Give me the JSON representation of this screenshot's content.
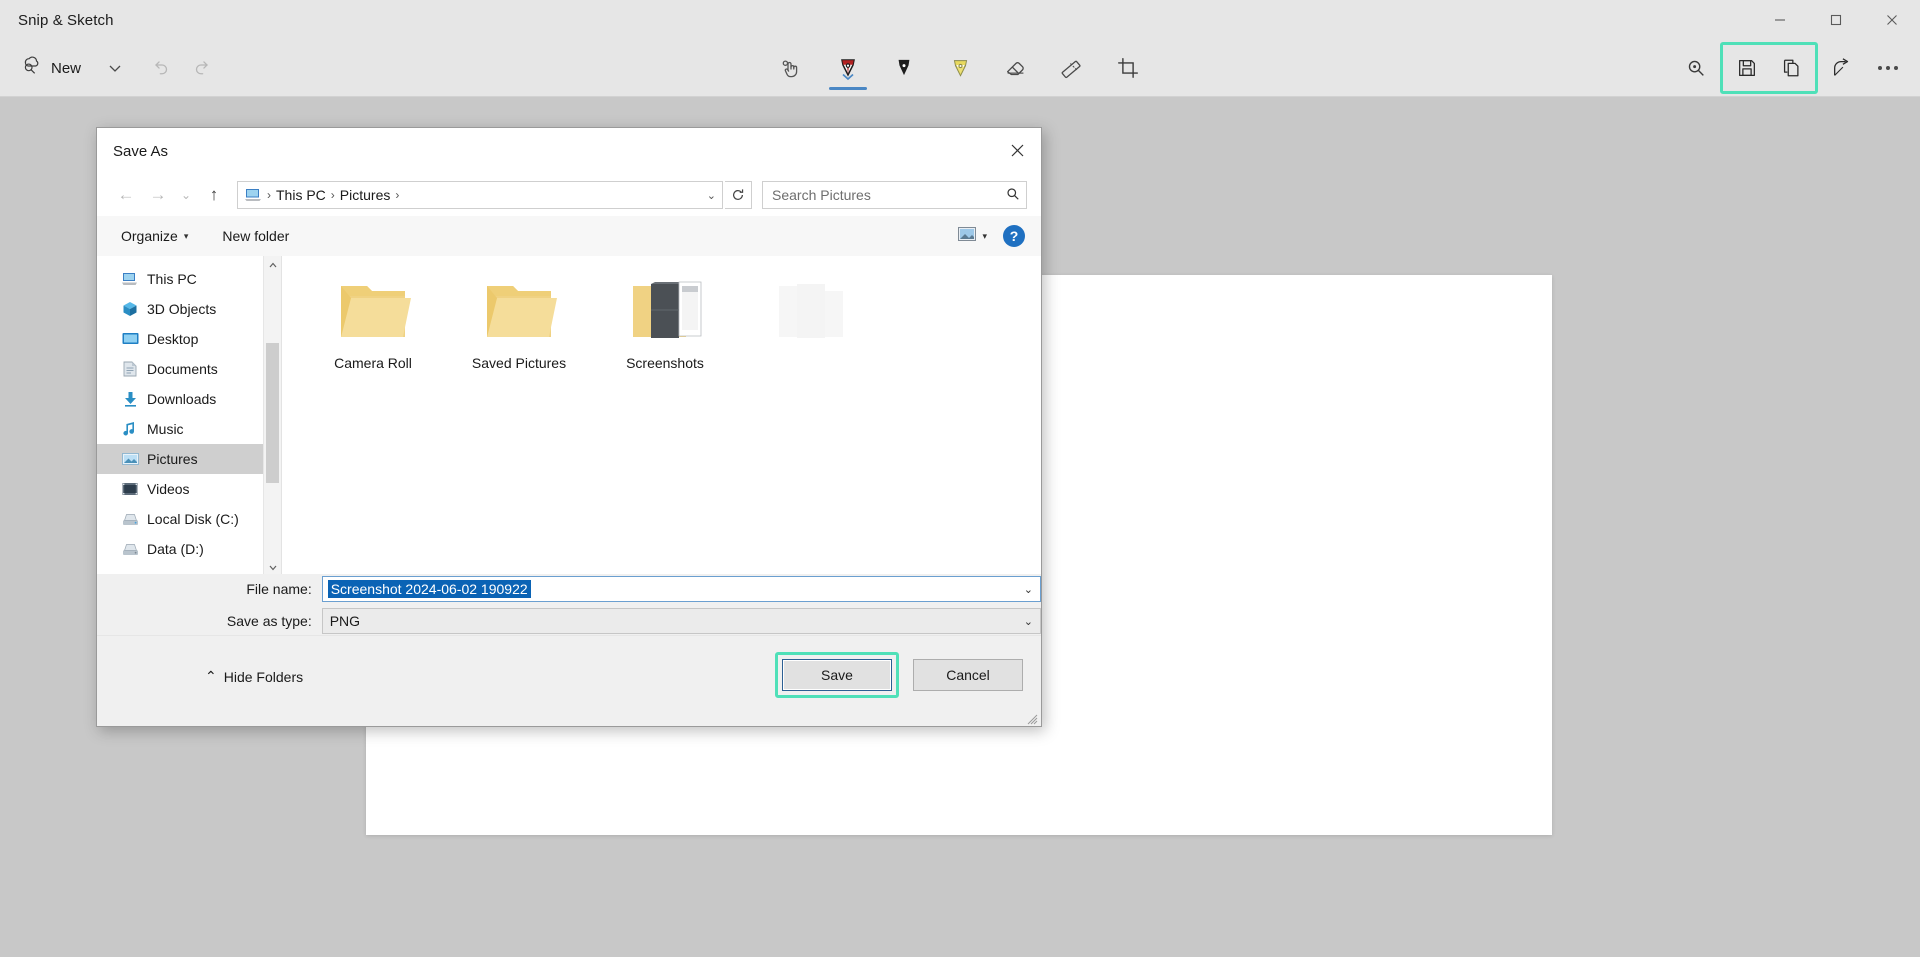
{
  "app": {
    "title": "Snip & Sketch",
    "window_controls": [
      {
        "name": "minimize",
        "glyph": "—"
      },
      {
        "name": "maximize",
        "glyph": "❐"
      },
      {
        "name": "close",
        "glyph": "✕"
      }
    ]
  },
  "toolbar": {
    "new_label": "New",
    "new_caret": "⌄",
    "undo_name": "undo-icon",
    "redo_name": "redo-icon",
    "tools": [
      {
        "id": "touch-writing",
        "label": "Touch writing",
        "color": "#6e6e6e",
        "selected": false
      },
      {
        "id": "ballpoint-pen",
        "label": "Ballpoint pen",
        "color": "#b22222",
        "selected": true
      },
      {
        "id": "pencil",
        "label": "Pencil",
        "color": "#1c1c1c",
        "selected": false
      },
      {
        "id": "highlighter",
        "label": "Highlighter",
        "color": "#e3d15a",
        "selected": false
      },
      {
        "id": "eraser",
        "label": "Eraser",
        "color": "#5a5a5a",
        "selected": false
      },
      {
        "id": "ruler",
        "label": "Ruler",
        "color": "#5a5a5a",
        "selected": false
      },
      {
        "id": "image-crop",
        "label": "Image crop",
        "color": "#3a3a3a",
        "selected": false
      }
    ],
    "right_actions": [
      {
        "id": "zoom",
        "label": "Zoom",
        "highlighted": false
      },
      {
        "id": "save-as",
        "label": "Save as",
        "highlighted": true
      },
      {
        "id": "copy",
        "label": "Copy",
        "highlighted": true
      },
      {
        "id": "share",
        "label": "Share",
        "highlighted": false
      },
      {
        "id": "see-more",
        "label": "See more",
        "highlighted": false
      }
    ],
    "highlight_color": "#4fe0b8"
  },
  "dialog": {
    "title": "Save As",
    "close_glyph": "✕",
    "nav": {
      "back_glyph": "←",
      "forward_glyph": "→",
      "recent_glyph": "⌄",
      "up_glyph": "↑",
      "breadcrumb": [
        "This PC",
        "Pictures"
      ],
      "breadcrumb_separator": "›",
      "breadcrumb_dropdown": "⌄",
      "refresh_glyph": "↻"
    },
    "search": {
      "placeholder": "Search Pictures"
    },
    "commandbar": {
      "organize_label": "Organize",
      "organize_caret": "▾",
      "new_folder_label": "New folder",
      "view_caret": "▾",
      "help_label": "?"
    },
    "nav_pane": {
      "items": [
        {
          "label": "This PC",
          "icon": "pc-icon",
          "selected": false
        },
        {
          "label": "3D Objects",
          "icon": "3d-objects-icon",
          "selected": false
        },
        {
          "label": "Desktop",
          "icon": "desktop-icon",
          "selected": false
        },
        {
          "label": "Documents",
          "icon": "documents-icon",
          "selected": false
        },
        {
          "label": "Downloads",
          "icon": "downloads-icon",
          "selected": false
        },
        {
          "label": "Music",
          "icon": "music-icon",
          "selected": false
        },
        {
          "label": "Pictures",
          "icon": "pictures-icon",
          "selected": true
        },
        {
          "label": "Videos",
          "icon": "videos-icon",
          "selected": false
        },
        {
          "label": "Local Disk (C:)",
          "icon": "disk-icon",
          "selected": false
        },
        {
          "label": "Data (D:)",
          "icon": "disk-icon",
          "selected": false
        }
      ],
      "scroll_up_glyph": "⌃",
      "scroll_down_glyph": "⌄"
    },
    "files": [
      {
        "label": "Camera Roll",
        "type": "folder",
        "ghost": false
      },
      {
        "label": "Saved Pictures",
        "type": "folder",
        "ghost": false
      },
      {
        "label": "Screenshots",
        "type": "folder-open",
        "ghost": false
      },
      {
        "label": "",
        "type": "folder",
        "ghost": true
      }
    ],
    "fields": {
      "file_name_label": "File name:",
      "file_name_value": "Screenshot 2024-06-02 190922",
      "save_as_type_label": "Save as type:",
      "save_as_type_value": "PNG",
      "dropdown_caret": "⌄"
    },
    "footer": {
      "hide_folders_label": "Hide Folders",
      "hide_folders_caret": "⌃",
      "save_label": "Save",
      "cancel_label": "Cancel",
      "save_highlight_color": "#4fe0b8"
    }
  }
}
